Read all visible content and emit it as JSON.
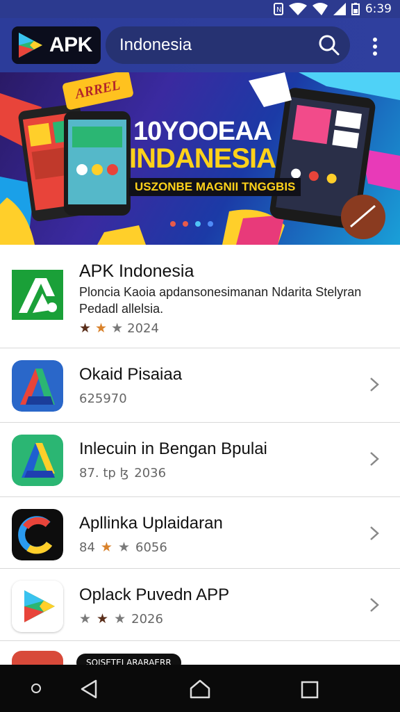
{
  "status_bar": {
    "time": "6:39"
  },
  "app_bar": {
    "logo_text": "APK",
    "search_text": "Indonesia"
  },
  "banner": {
    "stamp": "ARREL",
    "title_line1": "10YOOEAA",
    "title_line2": "INDANESIA",
    "tagline": "USZONBE MAGNII TNGGBIS",
    "dots": [
      "#e85a4a",
      "#e85a4a",
      "#4fc3f7",
      "#4f8bf7"
    ]
  },
  "featured": {
    "title": "APK Indonesia",
    "description": "Ploncia Kaoia apdansonesimanan Ndarita Stelyran Pedadl allelsia.",
    "stars": [
      true,
      true,
      true
    ],
    "star_colors": [
      "#5a2e1a",
      "#d9822b",
      "#7a7a7a"
    ],
    "meta": "2024"
  },
  "apps": [
    {
      "name": "Okaid Pisaiaa",
      "meta": "625970",
      "stars": []
    },
    {
      "name": "Inlecuin in Bengan Bpulai",
      "meta_prefix": "87. tp ɮ",
      "meta": "2036",
      "stars": []
    },
    {
      "name": "Apllinka  Uplaidaran",
      "meta_prefix": "84",
      "meta": "6056",
      "stars": [
        "#d9822b",
        "#7a7a7a"
      ]
    },
    {
      "name": "Oplack Puvedn APP",
      "meta": "2026",
      "stars": [
        "#7a7a7a",
        "#5a2e1a",
        "#7a7a7a"
      ]
    }
  ],
  "partial_row": {
    "pill_text": "SOISETEI ARARAERR"
  }
}
